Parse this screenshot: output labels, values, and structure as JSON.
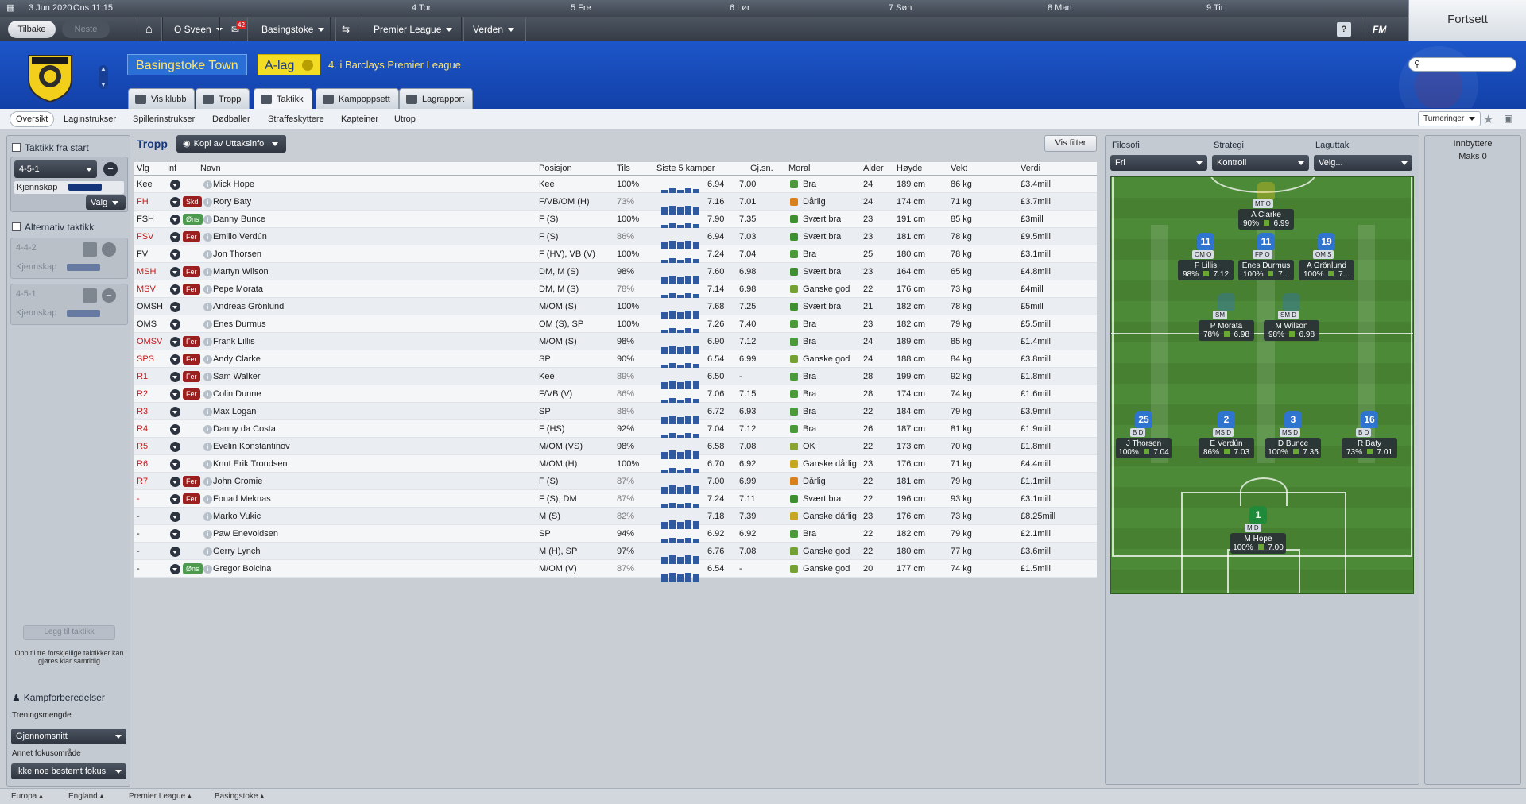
{
  "calendar": {
    "date": "3 Jun 2020",
    "weekday_time": "Ons  11:15",
    "days": [
      "4 Tor",
      "5 Fre",
      "6 Lør",
      "7 Søn",
      "8 Man",
      "9 Tir"
    ]
  },
  "nav": {
    "back": "Tilbake",
    "next": "Neste",
    "user": "O Sveen",
    "mail_count": "42",
    "club": "Basingstoke",
    "league": "Premier League",
    "world": "Verden",
    "continue": "Fortsett",
    "fm_label": "FM"
  },
  "club": {
    "name": "Basingstoke Town",
    "team": "A-lag",
    "rank": "4. i Barclays Premier League",
    "search_placeholder": ""
  },
  "tabs": [
    "Vis klubb",
    "Tropp",
    "Taktikk",
    "Kampoppsett",
    "Lagrapport"
  ],
  "subnav": [
    "Oversikt",
    "Laginstrukser",
    "Spillerinstrukser",
    "Dødballer",
    "Straffeskyttere",
    "Kapteiner",
    "Utrop"
  ],
  "subnav_right": "Turneringer",
  "left": {
    "start_tactic": "Taktikk fra start",
    "formation": "4-5-1",
    "familiarity": "Kjennskap",
    "select": "Valg",
    "alt_tactic": "Alternativ taktikk",
    "alt1": "4-4-2",
    "alt2": "4-5-1",
    "alt_fam": "Kjennskap",
    "add": "Legg til taktikk",
    "note": "Opp til tre forskjellige taktikker kan gjøres klar samtidig",
    "prep": "Kampforberedelser",
    "training": "Treningsmengde",
    "training_val": "Gjennomsnitt",
    "focus": "Annet fokusområde",
    "focus_val": "Ikke noe bestemt fokus"
  },
  "table": {
    "title": "Tropp",
    "view": "Kopi av Uttaksinfo",
    "filter": "Vis filter",
    "headers": [
      "Vlg",
      "Inf",
      "Navn",
      "Posisjon",
      "Tils",
      "Siste 5 kamper",
      "Gj.sn.",
      "Moral",
      "Alder",
      "Høyde",
      "Vekt",
      "Verdi"
    ],
    "rows": [
      {
        "vlg": "Kee",
        "inf": "",
        "name": "Mick Hope",
        "pos": "Kee",
        "cond": "100%",
        "form": "6.94",
        "avg": "7.00",
        "moral": "Bra",
        "age": "24",
        "h": "189 cm",
        "w": "86 kg",
        "val": "£3.4mill",
        "red": false
      },
      {
        "vlg": "FH",
        "inf": "Skd",
        "name": "Rory Baty",
        "pos": "F/VB/OM (H)",
        "cond": "73%",
        "form": "7.16",
        "avg": "7.01",
        "moral": "Dårlig",
        "age": "24",
        "h": "174 cm",
        "w": "71 kg",
        "val": "£3.7mill",
        "red": true
      },
      {
        "vlg": "FSH",
        "inf": "Øns",
        "name": "Danny Bunce",
        "pos": "F (S)",
        "cond": "100%",
        "form": "7.90",
        "avg": "7.35",
        "moral": "Svært bra",
        "age": "23",
        "h": "191 cm",
        "w": "85 kg",
        "val": "£3mill",
        "red": false
      },
      {
        "vlg": "FSV",
        "inf": "Fer",
        "name": "Emilio Verdún",
        "pos": "F (S)",
        "cond": "86%",
        "form": "6.94",
        "avg": "7.03",
        "moral": "Svært bra",
        "age": "23",
        "h": "181 cm",
        "w": "78 kg",
        "val": "£9.5mill",
        "red": true
      },
      {
        "vlg": "FV",
        "inf": "",
        "name": "Jon Thorsen",
        "pos": "F (HV), VB (V)",
        "cond": "100%",
        "form": "7.24",
        "avg": "7.04",
        "moral": "Bra",
        "age": "25",
        "h": "180 cm",
        "w": "78 kg",
        "val": "£3.1mill",
        "red": false
      },
      {
        "vlg": "MSH",
        "inf": "Fer",
        "name": "Martyn Wilson",
        "pos": "DM, M (S)",
        "cond": "98%",
        "form": "7.60",
        "avg": "6.98",
        "moral": "Svært bra",
        "age": "23",
        "h": "164 cm",
        "w": "65 kg",
        "val": "£4.8mill",
        "red": true
      },
      {
        "vlg": "MSV",
        "inf": "Fer",
        "name": "Pepe Morata",
        "pos": "DM, M (S)",
        "cond": "78%",
        "form": "7.14",
        "avg": "6.98",
        "moral": "Ganske god",
        "age": "22",
        "h": "176 cm",
        "w": "73 kg",
        "val": "£4mill",
        "red": true
      },
      {
        "vlg": "OMSH",
        "inf": "",
        "name": "Andreas Grönlund",
        "pos": "M/OM (S)",
        "cond": "100%",
        "form": "7.68",
        "avg": "7.25",
        "moral": "Svært bra",
        "age": "21",
        "h": "182 cm",
        "w": "78 kg",
        "val": "£5mill",
        "red": false
      },
      {
        "vlg": "OMS",
        "inf": "",
        "name": "Enes Durmus",
        "pos": "OM (S), SP",
        "cond": "100%",
        "form": "7.26",
        "avg": "7.40",
        "moral": "Bra",
        "age": "23",
        "h": "182 cm",
        "w": "79 kg",
        "val": "£5.5mill",
        "red": false
      },
      {
        "vlg": "OMSV",
        "inf": "Fer",
        "name": "Frank Lillis",
        "pos": "M/OM (S)",
        "cond": "98%",
        "form": "6.90",
        "avg": "7.12",
        "moral": "Bra",
        "age": "24",
        "h": "189 cm",
        "w": "85 kg",
        "val": "£1.4mill",
        "red": true
      },
      {
        "vlg": "SPS",
        "inf": "Fer",
        "name": "Andy Clarke",
        "pos": "SP",
        "cond": "90%",
        "form": "6.54",
        "avg": "6.99",
        "moral": "Ganske god",
        "age": "24",
        "h": "188 cm",
        "w": "84 kg",
        "val": "£3.8mill",
        "red": true
      },
      {
        "vlg": "R1",
        "inf": "Fer",
        "name": "Sam Walker",
        "pos": "Kee",
        "cond": "89%",
        "form": "6.50",
        "avg": "-",
        "moral": "Bra",
        "age": "28",
        "h": "199 cm",
        "w": "92 kg",
        "val": "£1.8mill",
        "red": true
      },
      {
        "vlg": "R2",
        "inf": "Fer",
        "name": "Colin Dunne",
        "pos": "F/VB (V)",
        "cond": "86%",
        "form": "7.06",
        "avg": "7.15",
        "moral": "Bra",
        "age": "28",
        "h": "174 cm",
        "w": "74 kg",
        "val": "£1.6mill",
        "red": true
      },
      {
        "vlg": "R3",
        "inf": "",
        "name": "Max Logan",
        "pos": "SP",
        "cond": "88%",
        "form": "6.72",
        "avg": "6.93",
        "moral": "Bra",
        "age": "22",
        "h": "184 cm",
        "w": "79 kg",
        "val": "£3.9mill",
        "red": true
      },
      {
        "vlg": "R4",
        "inf": "",
        "name": "Danny da Costa",
        "pos": "F (HS)",
        "cond": "92%",
        "form": "7.04",
        "avg": "7.12",
        "moral": "Bra",
        "age": "26",
        "h": "187 cm",
        "w": "81 kg",
        "val": "£1.9mill",
        "red": true
      },
      {
        "vlg": "R5",
        "inf": "",
        "name": "Evelin Konstantinov",
        "pos": "M/OM (VS)",
        "cond": "98%",
        "form": "6.58",
        "avg": "7.08",
        "moral": "OK",
        "age": "22",
        "h": "173 cm",
        "w": "70 kg",
        "val": "£1.8mill",
        "red": true
      },
      {
        "vlg": "R6",
        "inf": "",
        "name": "Knut Erik Trondsen",
        "pos": "M/OM (H)",
        "cond": "100%",
        "form": "6.70",
        "avg": "6.92",
        "moral": "Ganske dårlig",
        "age": "23",
        "h": "176 cm",
        "w": "71 kg",
        "val": "£4.4mill",
        "red": true
      },
      {
        "vlg": "R7",
        "inf": "Fer",
        "name": "John Cromie",
        "pos": "F (S)",
        "cond": "87%",
        "form": "7.00",
        "avg": "6.99",
        "moral": "Dårlig",
        "age": "22",
        "h": "181 cm",
        "w": "79 kg",
        "val": "£1.1mill",
        "red": true
      },
      {
        "vlg": "-",
        "inf": "Fer",
        "name": "Fouad Meknas",
        "pos": "F (S), DM",
        "cond": "87%",
        "form": "7.24",
        "avg": "7.11",
        "moral": "Svært bra",
        "age": "22",
        "h": "196 cm",
        "w": "93 kg",
        "val": "£3.1mill",
        "red": true
      },
      {
        "vlg": "-",
        "inf": "",
        "name": "Marko Vukic",
        "pos": "M (S)",
        "cond": "82%",
        "form": "7.18",
        "avg": "7.39",
        "moral": "Ganske dårlig",
        "age": "23",
        "h": "176 cm",
        "w": "73 kg",
        "val": "£8.25mill",
        "red": false
      },
      {
        "vlg": "-",
        "inf": "",
        "name": "Paw Enevoldsen",
        "pos": "SP",
        "cond": "94%",
        "form": "6.92",
        "avg": "6.92",
        "moral": "Bra",
        "age": "22",
        "h": "182 cm",
        "w": "79 kg",
        "val": "£2.1mill",
        "red": false
      },
      {
        "vlg": "-",
        "inf": "",
        "name": "Gerry Lynch",
        "pos": "M (H), SP",
        "cond": "97%",
        "form": "6.76",
        "avg": "7.08",
        "moral": "Ganske god",
        "age": "22",
        "h": "180 cm",
        "w": "77 kg",
        "val": "£3.6mill",
        "red": false
      },
      {
        "vlg": "-",
        "inf": "Øns",
        "name": "Gregor Bolcina",
        "pos": "M/OM (V)",
        "cond": "87%",
        "form": "6.54",
        "avg": "-",
        "moral": "Ganske god",
        "age": "20",
        "h": "177 cm",
        "w": "74 kg",
        "val": "£1.5mill",
        "red": false
      }
    ]
  },
  "pitch": {
    "philosophy_label": "Filosofi",
    "philosophy": "Fri",
    "strategy_label": "Strategi",
    "strategy": "Kontroll",
    "shape_label": "Laguttak",
    "shape": "Velg...",
    "players": [
      {
        "num": "",
        "role": "MT",
        "duty": "O",
        "name": "A Clarke",
        "cond": "90%",
        "rating": "6.99",
        "shirt": "#e3c11b"
      },
      {
        "num": "11",
        "role": "OM",
        "duty": "O",
        "name": "F Lillis",
        "cond": "98%",
        "rating": "7.12",
        "shirt": "#2f74cf"
      },
      {
        "num": "11",
        "role": "FP",
        "duty": "O",
        "name": "Enes Durmus",
        "cond": "100%",
        "rating": "7...",
        "shirt": "#2f74cf"
      },
      {
        "num": "19",
        "role": "OM",
        "duty": "S",
        "name": "A Grönlund",
        "cond": "100%",
        "rating": "7...",
        "shirt": "#2f74cf"
      },
      {
        "num": "",
        "role": "SM",
        "duty": "",
        "name": "P Morata",
        "cond": "78%",
        "rating": "6.98",
        "shirt": "#2f74cf"
      },
      {
        "num": "",
        "role": "SM",
        "duty": "D",
        "name": "M Wilson",
        "cond": "98%",
        "rating": "6.98",
        "shirt": "#2f74cf"
      },
      {
        "num": "25",
        "role": "B",
        "duty": "D",
        "name": "J Thorsen",
        "cond": "100%",
        "rating": "7.04",
        "shirt": "#2f74cf"
      },
      {
        "num": "2",
        "role": "MS",
        "duty": "D",
        "name": "E Verdún",
        "cond": "86%",
        "rating": "7.03",
        "shirt": "#2f74cf"
      },
      {
        "num": "3",
        "role": "MS",
        "duty": "D",
        "name": "D Bunce",
        "cond": "100%",
        "rating": "7.35",
        "shirt": "#2f74cf"
      },
      {
        "num": "16",
        "role": "B",
        "duty": "D",
        "name": "R Baty",
        "cond": "73%",
        "rating": "7.01",
        "shirt": "#2f74cf"
      },
      {
        "num": "1",
        "role": "M",
        "duty": "D",
        "name": "M Hope",
        "cond": "100%",
        "rating": "7.00",
        "shirt": "#1f8a3a"
      }
    ]
  },
  "subs": {
    "title": "Innbyttere",
    "max": "Maks 0"
  },
  "footer": [
    "Europa",
    "England",
    "Premier League",
    "Basingstoke"
  ],
  "colors": {
    "header": "#1d56c9",
    "accent_yellow": "#f3dc24",
    "injury_badge": "#9b1f1f",
    "wish_badge": "#4d9a4f",
    "form_bar": "#2f5aa0"
  }
}
